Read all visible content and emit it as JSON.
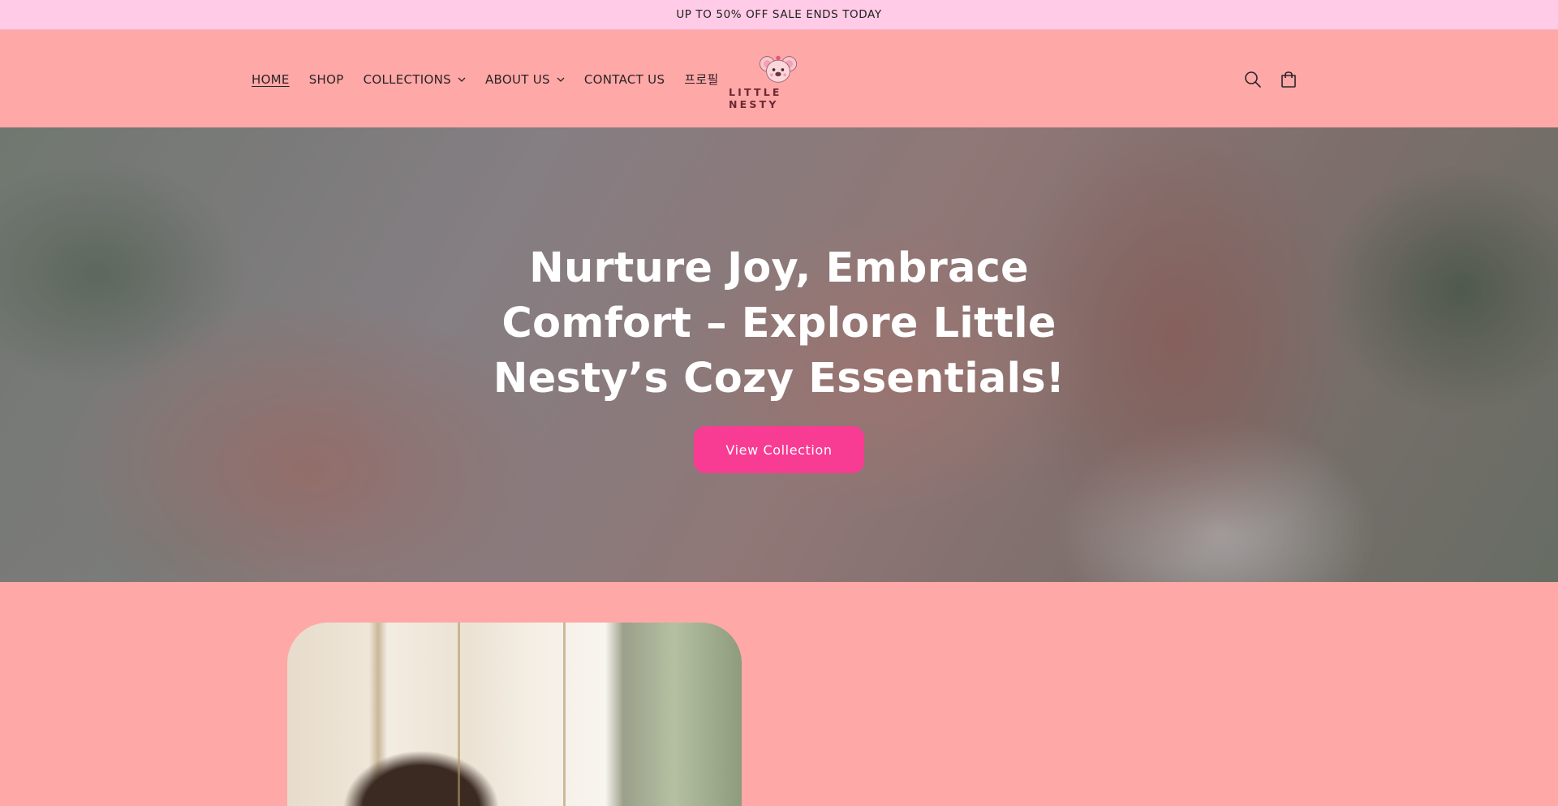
{
  "announcement": {
    "text": "UP TO 50% OFF SALE ENDS TODAY"
  },
  "nav": {
    "items": [
      {
        "label": "HOME",
        "active": true,
        "dropdown": false
      },
      {
        "label": "SHOP",
        "active": false,
        "dropdown": false
      },
      {
        "label": "COLLECTIONS",
        "active": false,
        "dropdown": true
      },
      {
        "label": "ABOUT US",
        "active": false,
        "dropdown": true
      },
      {
        "label": "CONTACT US",
        "active": false,
        "dropdown": false
      },
      {
        "label": "프로필",
        "active": false,
        "dropdown": false
      }
    ]
  },
  "logo": {
    "text": "LITTLE NESTY",
    "icon": "koala-face-icon"
  },
  "header_icons": {
    "search": "search-icon",
    "cart": "cart-icon"
  },
  "hero": {
    "title": "Nurture Joy, Embrace Comfort – Explore Little Nesty’s Cozy Essentials!",
    "button_label": "View Collection"
  },
  "colors": {
    "announcement_bg": "#ffcbe6",
    "header_bg": "#ffa8a8",
    "button_bg": "#f83c93",
    "text_dark": "#2b2424"
  }
}
